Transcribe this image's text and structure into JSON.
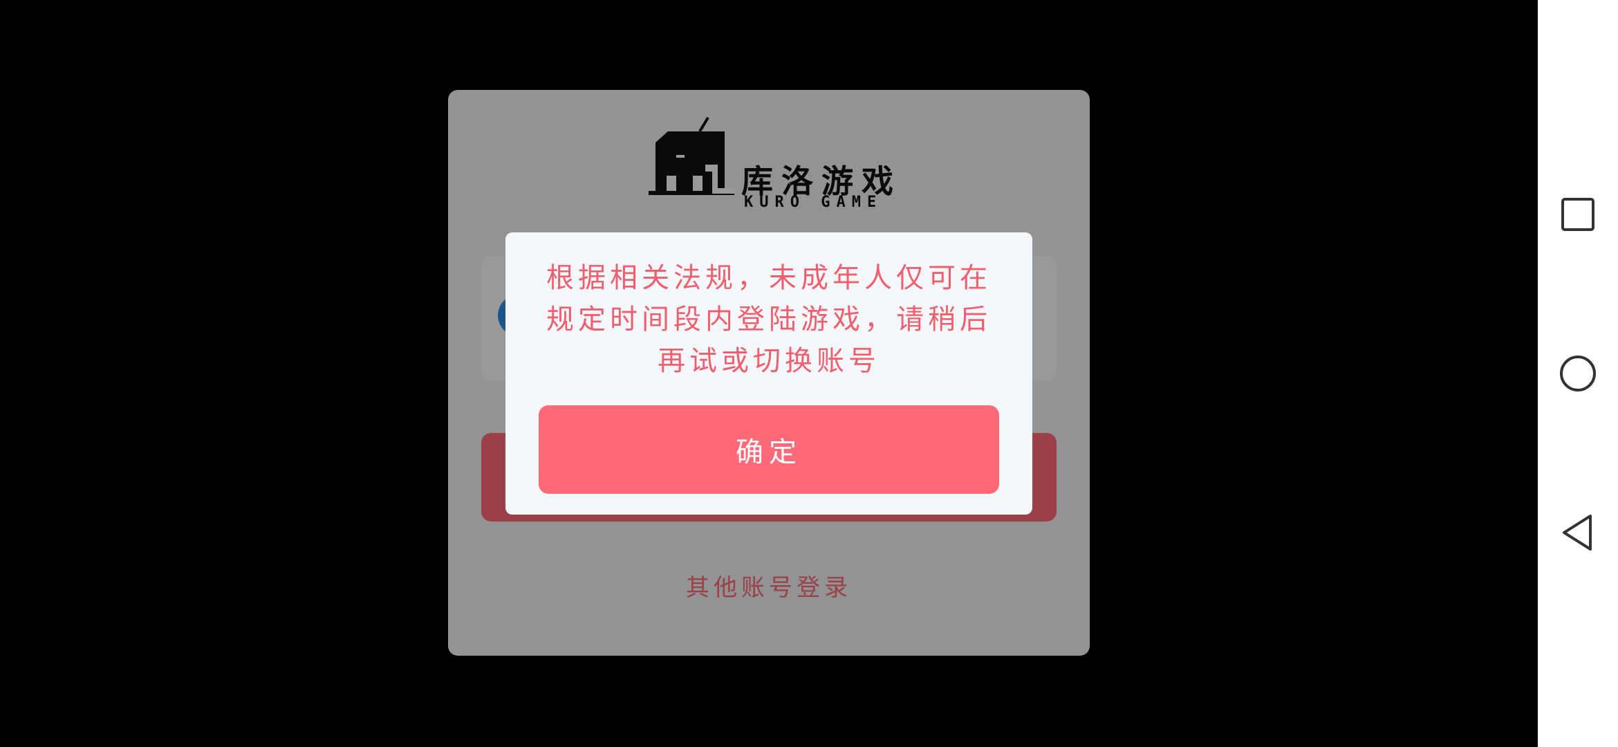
{
  "login": {
    "brand_cn": "库洛游戏",
    "brand_en": "KURO GAME",
    "other_login_label": "其他账号登录"
  },
  "dialog": {
    "message": "根据相关法规，未成年人仅可在规定时间段内登陆游戏，请稍后再试或切换账号",
    "confirm_label": "确定"
  },
  "navbar": {
    "recent_icon": "square-icon",
    "home_icon": "circle-icon",
    "back_icon": "triangle-back-icon"
  },
  "colors": {
    "accent": "#ff6978",
    "dialog_text": "#ef5f6e",
    "avatar_blue": "#2b8fe6"
  }
}
